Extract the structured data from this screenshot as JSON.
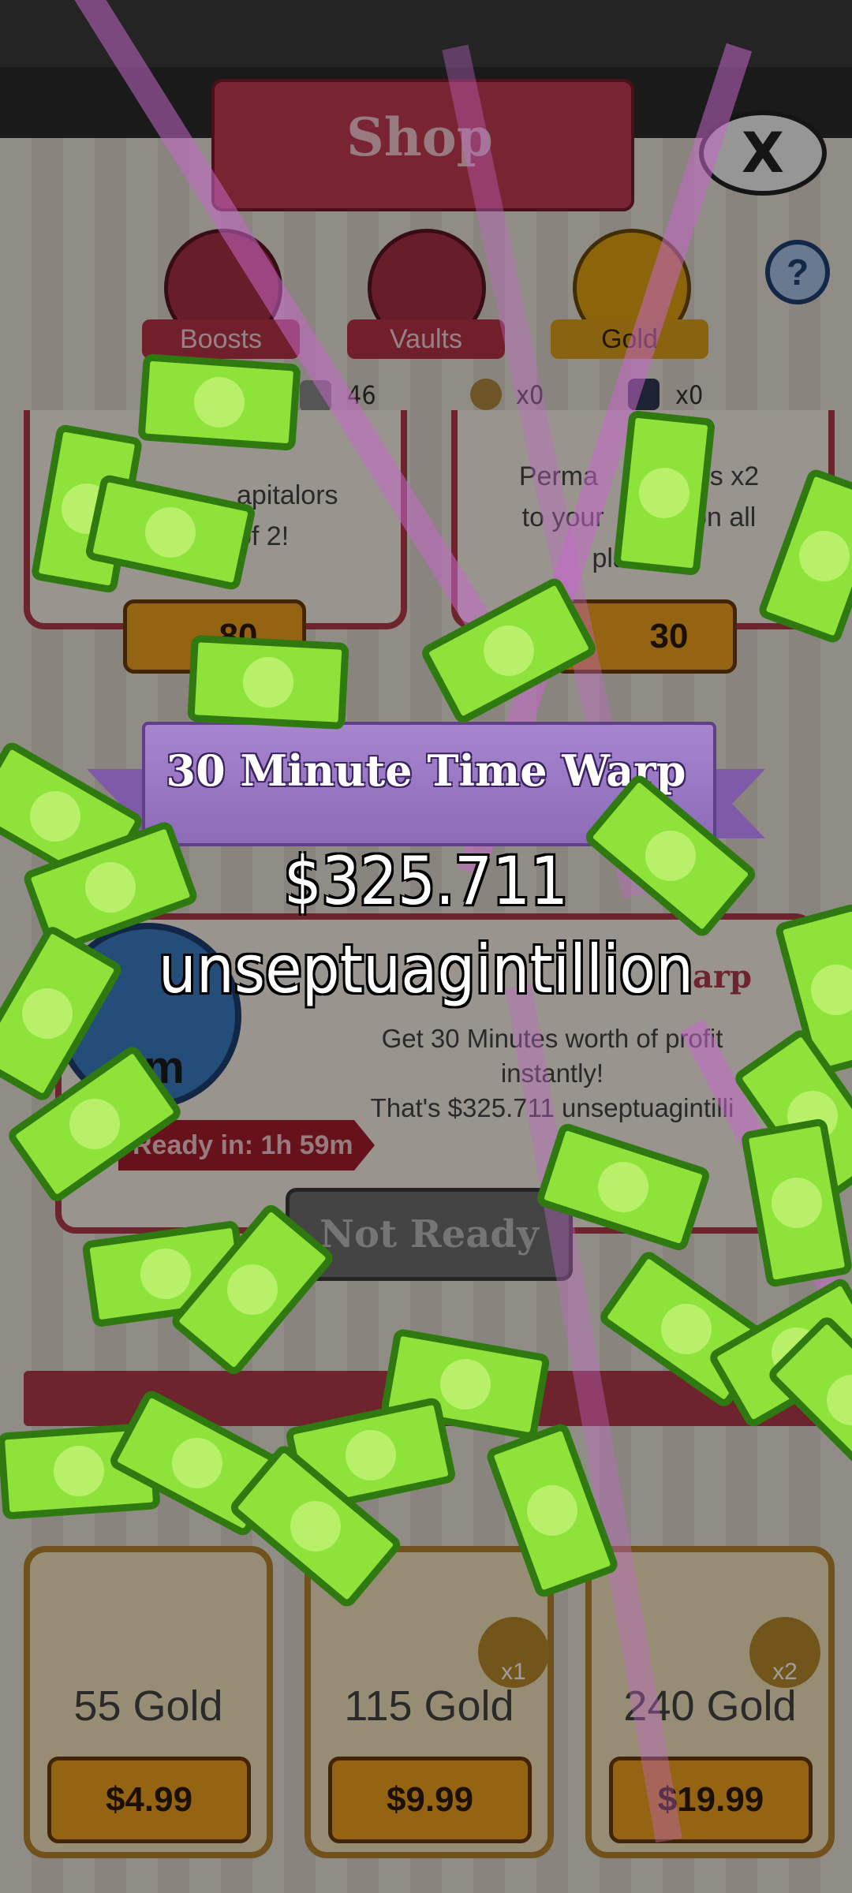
{
  "shop": {
    "title": "Shop",
    "close_label": "X",
    "help_label": "?",
    "tabs": [
      {
        "label": "Boosts"
      },
      {
        "label": "Vaults"
      },
      {
        "label": "Gold"
      }
    ],
    "currency_counts": {
      "gold": "46",
      "money_bags": "x0",
      "tickets": "x0"
    },
    "boost_cards": [
      {
        "desc_line1": "apitalors",
        "desc_line2": "of 2!",
        "price": "80"
      },
      {
        "desc_line1": "Perma         adds x2",
        "desc_line2": "to your        st on all",
        "desc_line3": "planets!",
        "price": "30"
      }
    ],
    "time_warp_card": {
      "title_fragment": "arp",
      "badge": "0m",
      "desc_line1": "Get 30 Minutes worth of profit",
      "desc_line2": "instantly!",
      "desc_line3": "That's $325.711 unseptuagintilli",
      "ready_in": "Ready in: 1h 59m",
      "button_label": "Not Ready"
    },
    "gold_packs": [
      {
        "label": "55 Gold",
        "price": "$4.99"
      },
      {
        "label": "115 Gold",
        "price": "$9.99",
        "badge": "x1"
      },
      {
        "label": "240 Gold",
        "price": "$19.99",
        "badge": "x2"
      }
    ]
  },
  "overlay": {
    "ribbon_title": "30 Minute Time Warp",
    "amount_value": "$325.711",
    "amount_unit": "unseptuagintillion"
  },
  "colors": {
    "ribbon": "#9b78c4",
    "cash": "#8de33a",
    "shop_red": "#b23a4a",
    "gold_button": "#f0a21d"
  }
}
